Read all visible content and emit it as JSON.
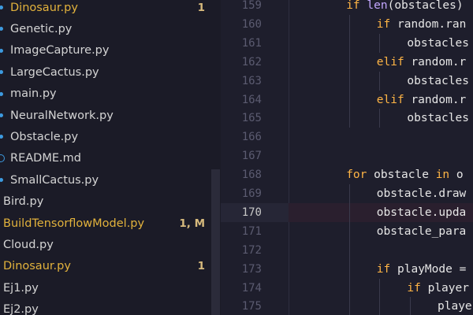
{
  "explorer": {
    "files": [
      {
        "name": "Dinosaur.py",
        "badge": "1",
        "modified": true,
        "indent": true,
        "marker": "dot"
      },
      {
        "name": "Genetic.py",
        "badge": "",
        "modified": false,
        "indent": true,
        "marker": "dot"
      },
      {
        "name": "ImageCapture.py",
        "badge": "",
        "modified": false,
        "indent": true,
        "marker": "dot"
      },
      {
        "name": "LargeCactus.py",
        "badge": "",
        "modified": false,
        "indent": true,
        "marker": "dot"
      },
      {
        "name": "main.py",
        "badge": "",
        "modified": false,
        "indent": true,
        "marker": "dot"
      },
      {
        "name": "NeuralNetwork.py",
        "badge": "",
        "modified": false,
        "indent": true,
        "marker": "dot"
      },
      {
        "name": "Obstacle.py",
        "badge": "",
        "modified": false,
        "indent": true,
        "marker": "dot"
      },
      {
        "name": "README.md",
        "badge": "",
        "modified": false,
        "indent": true,
        "marker": "info"
      },
      {
        "name": "SmallCactus.py",
        "badge": "",
        "modified": false,
        "indent": true,
        "marker": "dot"
      },
      {
        "name": "Bird.py",
        "badge": "",
        "modified": false,
        "indent": false,
        "marker": ""
      },
      {
        "name": "BuildTensorflowModel.py",
        "badge": "1, M",
        "modified": true,
        "indent": false,
        "marker": ""
      },
      {
        "name": "Cloud.py",
        "badge": "",
        "modified": false,
        "indent": false,
        "marker": ""
      },
      {
        "name": "Dinosaur.py",
        "badge": "1",
        "modified": true,
        "indent": false,
        "marker": ""
      },
      {
        "name": "Ej1.py",
        "badge": "",
        "modified": false,
        "indent": false,
        "marker": ""
      },
      {
        "name": "Ej2.py",
        "badge": "",
        "modified": false,
        "indent": false,
        "marker": ""
      }
    ]
  },
  "editor": {
    "current_line": 170,
    "lines": [
      {
        "n": "159",
        "indent": 2,
        "tokens": [
          {
            "t": "if ",
            "c": "kw"
          },
          {
            "t": "len",
            "c": "fn"
          },
          {
            "t": "(obstacles)",
            "c": ""
          }
        ]
      },
      {
        "n": "160",
        "indent": 3,
        "tokens": [
          {
            "t": "if ",
            "c": "kw"
          },
          {
            "t": "random.ran",
            "c": ""
          }
        ]
      },
      {
        "n": "161",
        "indent": 4,
        "tokens": [
          {
            "t": "obstacles",
            "c": ""
          }
        ]
      },
      {
        "n": "162",
        "indent": 3,
        "tokens": [
          {
            "t": "elif ",
            "c": "kw"
          },
          {
            "t": "random.r",
            "c": ""
          }
        ]
      },
      {
        "n": "163",
        "indent": 4,
        "tokens": [
          {
            "t": "obstacles",
            "c": ""
          }
        ]
      },
      {
        "n": "164",
        "indent": 3,
        "tokens": [
          {
            "t": "elif ",
            "c": "kw"
          },
          {
            "t": "random.r",
            "c": ""
          }
        ]
      },
      {
        "n": "165",
        "indent": 4,
        "tokens": [
          {
            "t": "obstacles",
            "c": ""
          }
        ]
      },
      {
        "n": "166",
        "indent": 0,
        "tokens": []
      },
      {
        "n": "167",
        "indent": 0,
        "tokens": []
      },
      {
        "n": "168",
        "indent": 2,
        "tokens": [
          {
            "t": "for ",
            "c": "kw"
          },
          {
            "t": "obstacle ",
            "c": ""
          },
          {
            "t": "in ",
            "c": "kw"
          },
          {
            "t": "o",
            "c": ""
          }
        ]
      },
      {
        "n": "169",
        "indent": 3,
        "tokens": [
          {
            "t": "obstacle.draw",
            "c": ""
          }
        ]
      },
      {
        "n": "170",
        "indent": 3,
        "tokens": [
          {
            "t": "obstacle.upda",
            "c": ""
          }
        ]
      },
      {
        "n": "171",
        "indent": 3,
        "tokens": [
          {
            "t": "obstacle_para",
            "c": ""
          }
        ]
      },
      {
        "n": "172",
        "indent": 0,
        "tokens": []
      },
      {
        "n": "173",
        "indent": 3,
        "tokens": [
          {
            "t": "if ",
            "c": "kw"
          },
          {
            "t": "playMode =",
            "c": ""
          }
        ]
      },
      {
        "n": "174",
        "indent": 4,
        "tokens": [
          {
            "t": "if ",
            "c": "kw"
          },
          {
            "t": "player",
            "c": ""
          }
        ]
      },
      {
        "n": "175",
        "indent": 5,
        "tokens": [
          {
            "t": "playe",
            "c": ""
          }
        ]
      }
    ]
  }
}
